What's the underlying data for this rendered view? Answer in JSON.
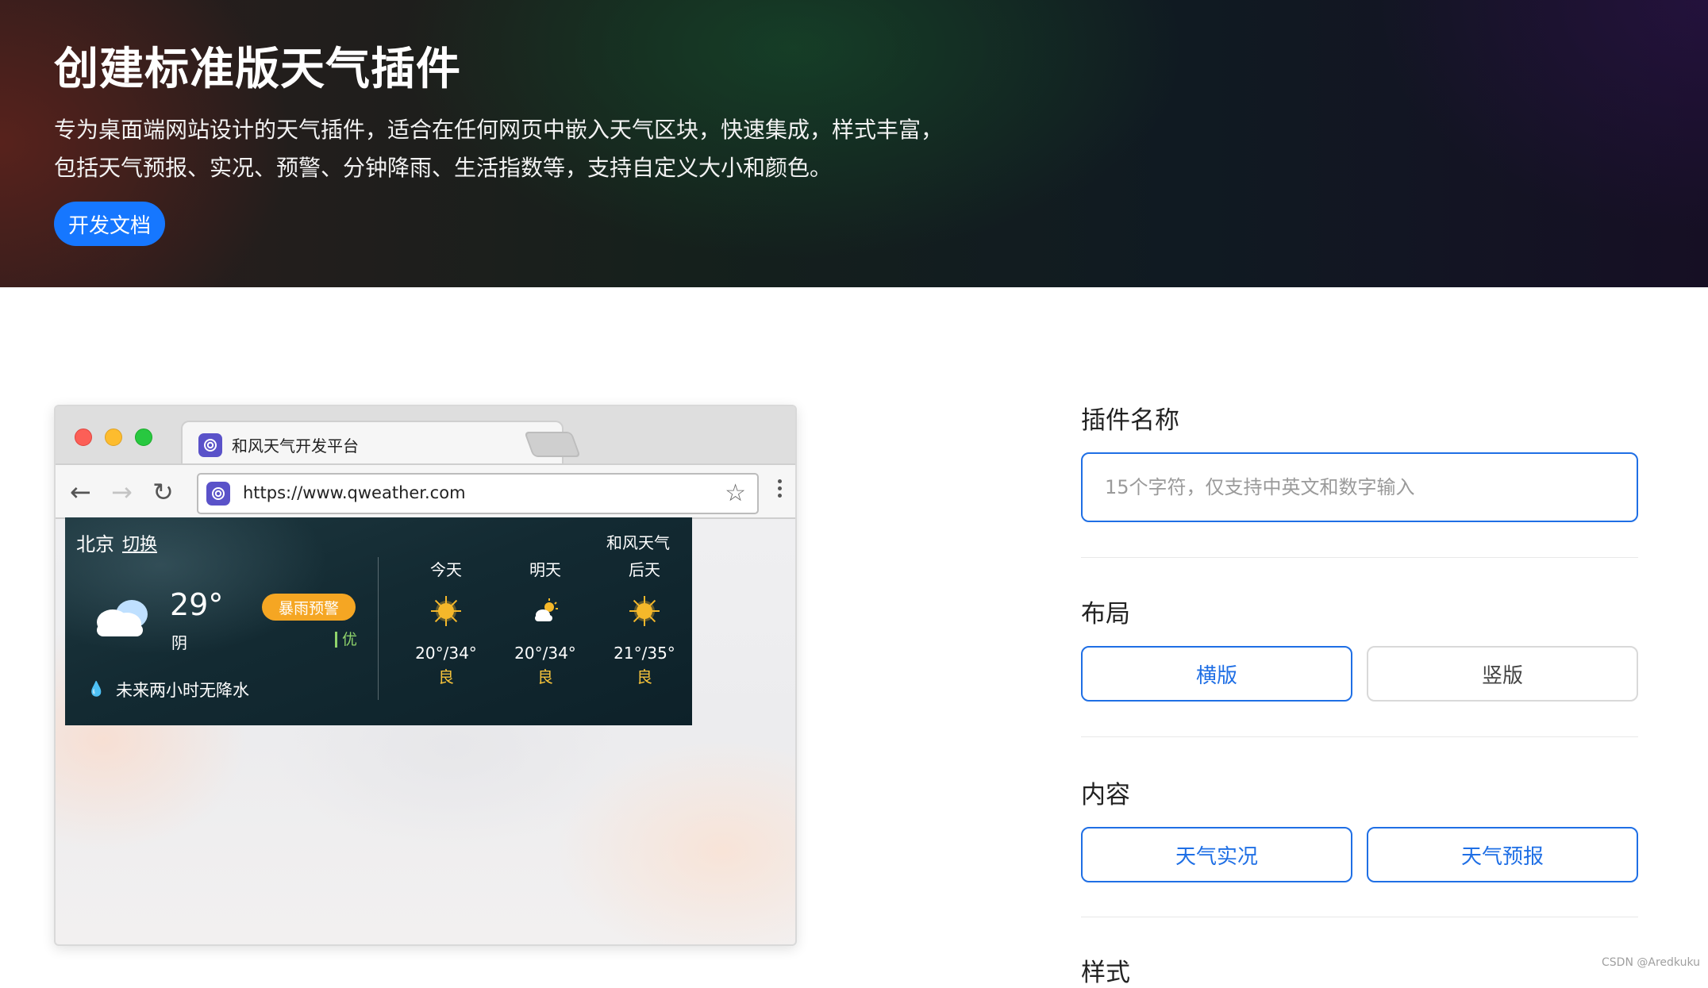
{
  "hero": {
    "title": "创建标准版天气插件",
    "description": "专为桌面端网站设计的天气插件，适合在任何网页中嵌入天气区块，快速集成，样式丰富，包括天气预报、实况、预警、分钟降雨、生活指数等，支持自定义大小和颜色。",
    "docs_button": "开发文档"
  },
  "browser": {
    "tab_title": "和风天气开发平台",
    "url": "https://www.qweather.com"
  },
  "widget": {
    "city": "北京",
    "switch_label": "切换",
    "brand": "和风天气",
    "current_temp": "29°",
    "condition": "阴",
    "alert": "暴雨预警",
    "aqi": "优",
    "rain_note": "未来两小时无降水",
    "forecast": [
      {
        "day": "今天",
        "icon": "sun-icon",
        "temp": "20°/34°",
        "aqi": "良"
      },
      {
        "day": "明天",
        "icon": "partly-cloudy-icon",
        "temp": "20°/34°",
        "aqi": "良"
      },
      {
        "day": "后天",
        "icon": "sun-icon",
        "temp": "21°/35°",
        "aqi": "良"
      }
    ]
  },
  "form": {
    "name_label": "插件名称",
    "name_placeholder": "15个字符，仅支持中英文和数字输入",
    "layout_label": "布局",
    "layout_options": [
      "横版",
      "竖版"
    ],
    "content_label": "内容",
    "content_options": [
      "天气实况",
      "天气预报"
    ],
    "style_label": "样式"
  },
  "watermark": "CSDN @Aredkuku",
  "colors": {
    "accent": "#1677ff",
    "alert": "#f5a623",
    "aqi_good": "#8fd36b",
    "aqi_moderate": "#f5c23a"
  }
}
